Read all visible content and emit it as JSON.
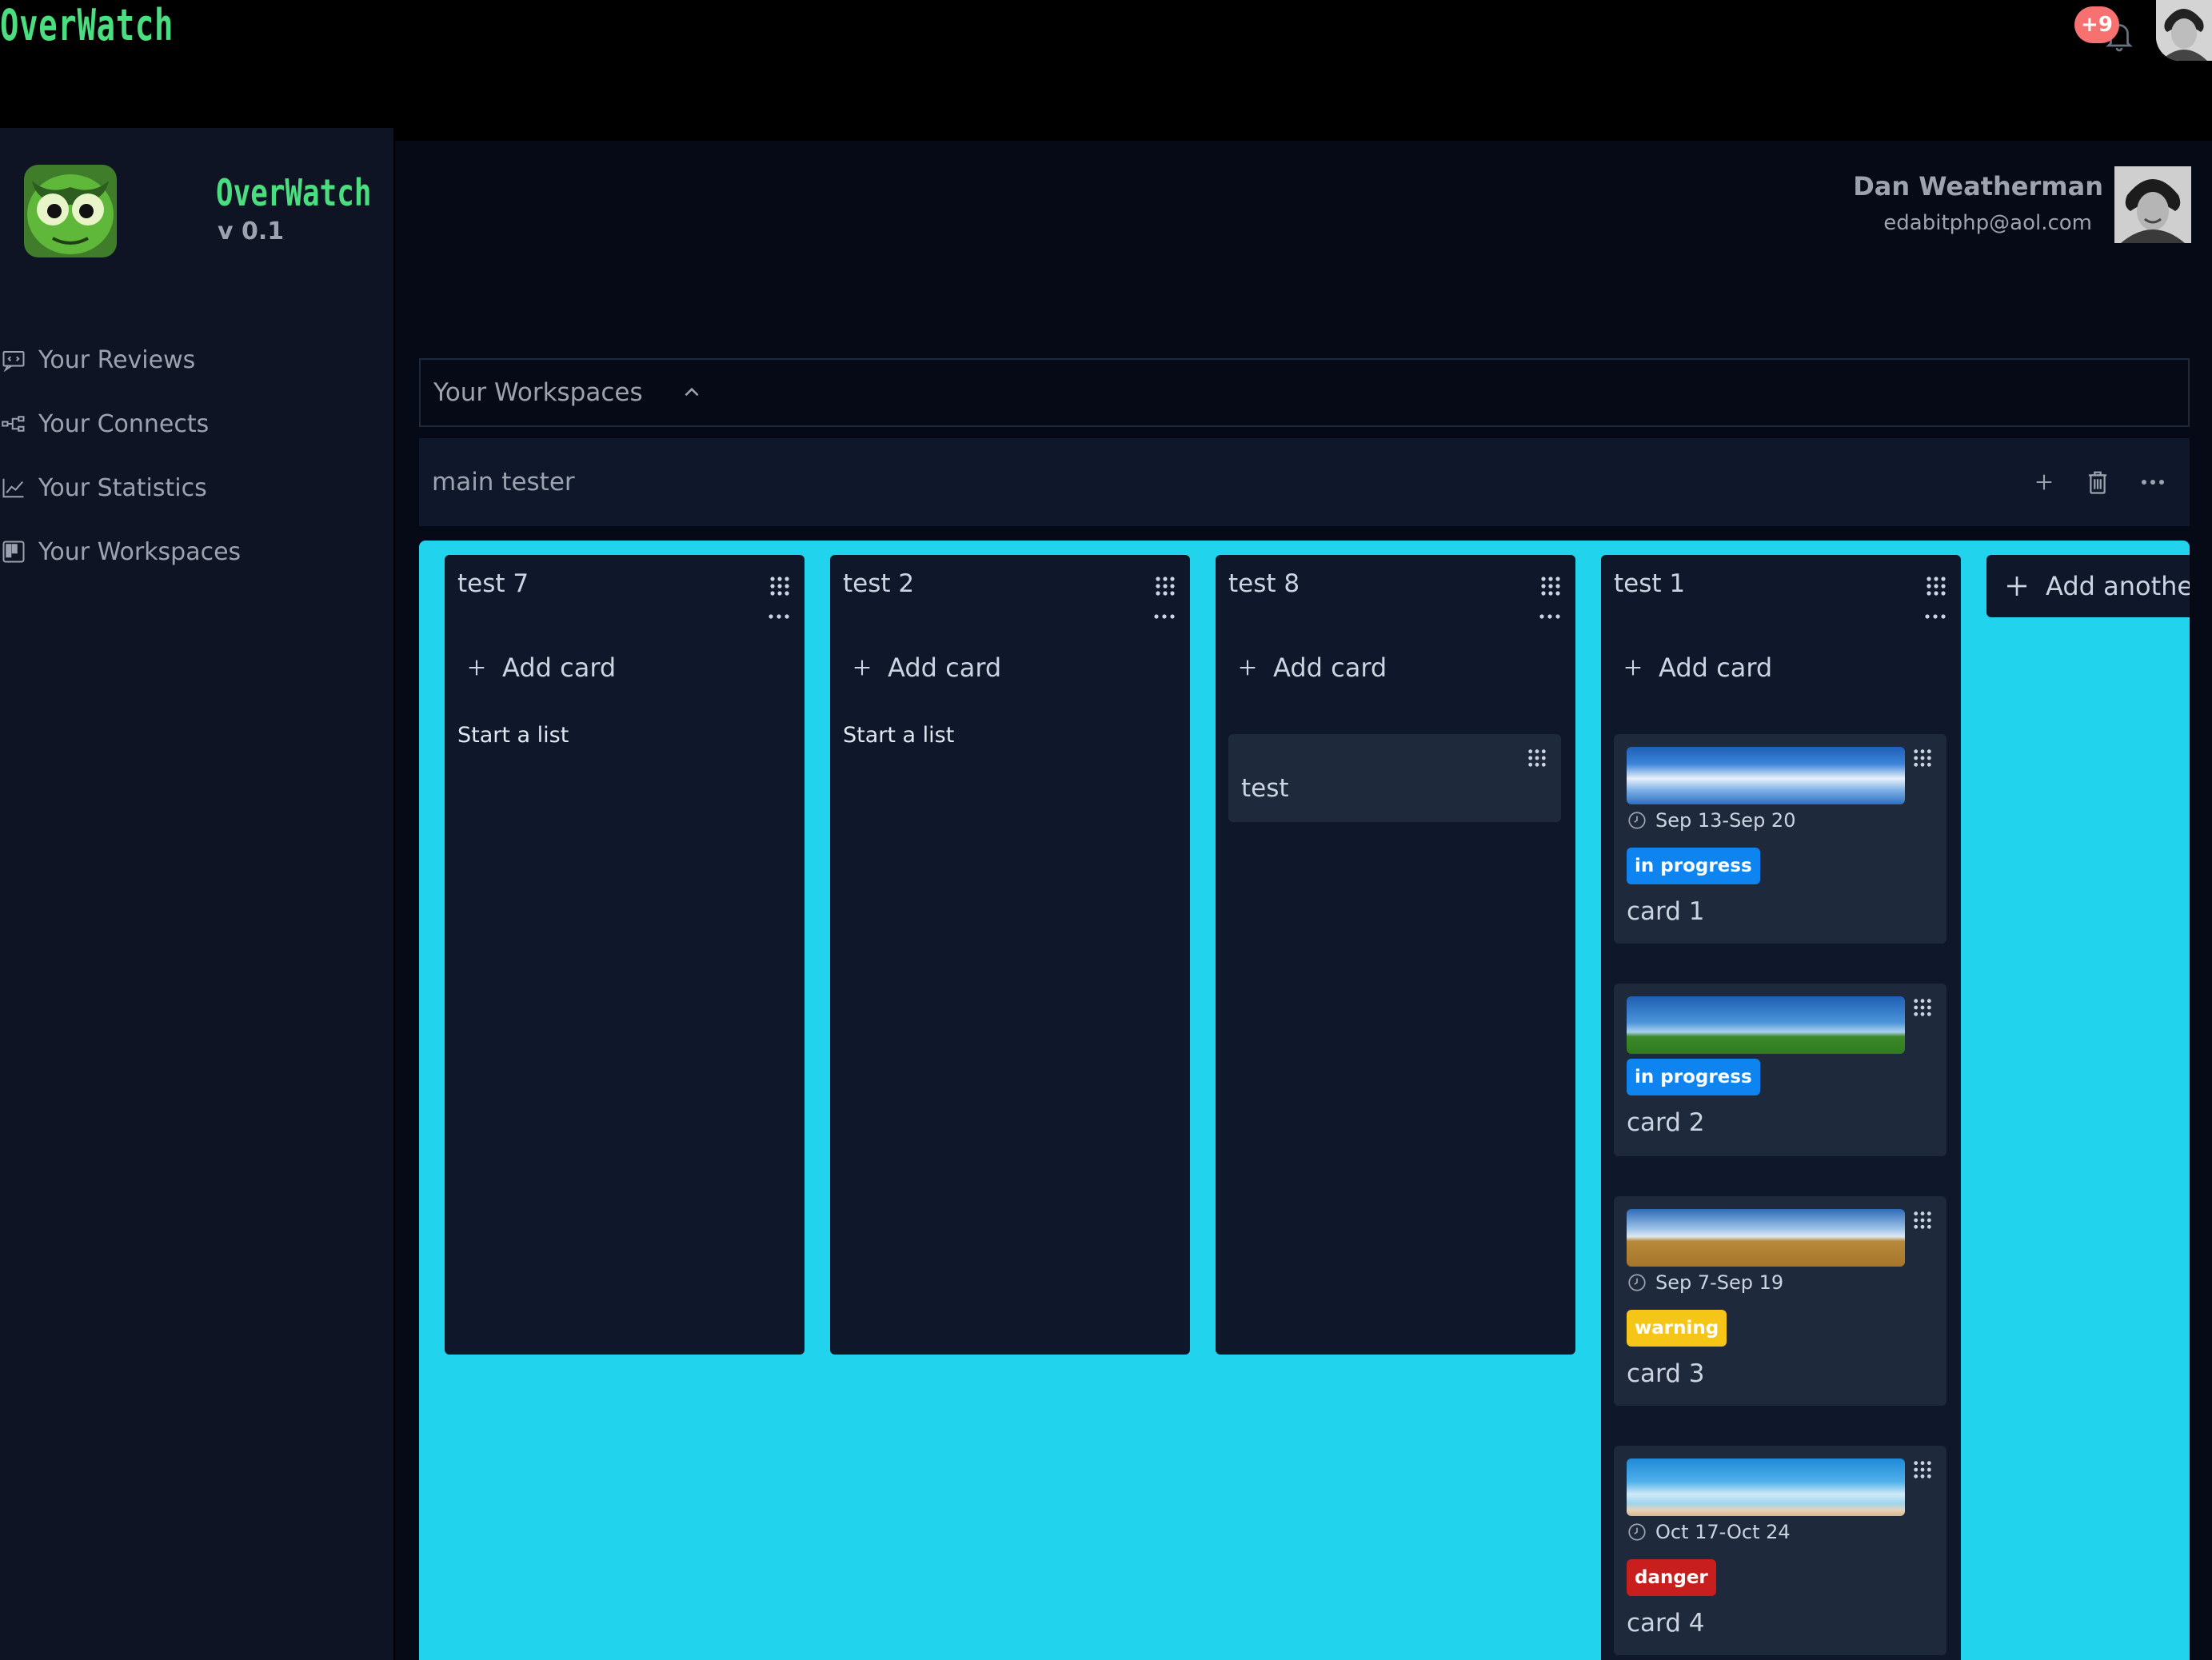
{
  "app": {
    "brand": "OverWatch",
    "notification_count": "+9"
  },
  "sidebar": {
    "title": "OverWatch",
    "version": "v 0.1",
    "items": [
      {
        "label": "Your Reviews",
        "icon": "reviews-icon"
      },
      {
        "label": "Your Connects",
        "icon": "connects-icon"
      },
      {
        "label": "Your Statistics",
        "icon": "statistics-icon"
      },
      {
        "label": "Your Workspaces",
        "icon": "workspaces-icon"
      }
    ]
  },
  "user": {
    "name": "Dan Weatherman",
    "email": "edabitphp@aol.com"
  },
  "workspaces": {
    "label": "Your Workspaces"
  },
  "board": {
    "name": "main tester",
    "color": "#22d3ee",
    "lists": [
      {
        "title": "test 7",
        "add_label": "Add card",
        "empty_label": "Start a list"
      },
      {
        "title": "test 2",
        "add_label": "Add card",
        "empty_label": "Start a list"
      },
      {
        "title": "test 8",
        "add_label": "Add card",
        "cards": [
          {
            "title": "test"
          }
        ]
      },
      {
        "title": "test 1",
        "add_label": "Add card",
        "cards": [
          {
            "title": "card 1",
            "date": "Sep 13-Sep 20",
            "tag": "in progress",
            "tag_color": "#0d84f0"
          },
          {
            "title": "card 2",
            "tag": "in progress",
            "tag_color": "#0d84f0"
          },
          {
            "title": "card 3",
            "date": "Sep 7-Sep 19",
            "tag": "warning",
            "tag_color": "#f5c518"
          },
          {
            "title": "card 4",
            "date": "Oct 17-Oct 24",
            "tag": "danger",
            "tag_color": "#c81e1e"
          }
        ]
      }
    ],
    "add_list_label": "Add another"
  }
}
